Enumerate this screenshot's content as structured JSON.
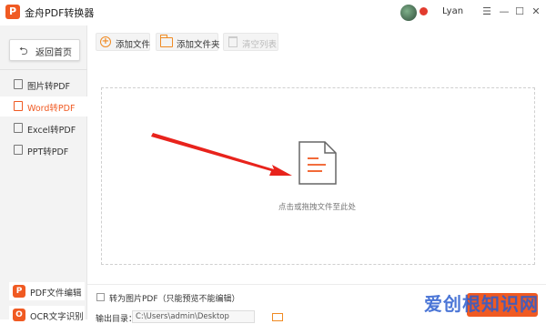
{
  "app": {
    "title": "金舟PDF转换器",
    "logo_text": "P"
  },
  "user": {
    "name": "Lyan"
  },
  "window": {
    "menu": "☰",
    "minimize": "—",
    "maximize": "☐",
    "close": "✕"
  },
  "sidebar": {
    "home": "返回首页",
    "items": [
      {
        "label": "图片转PDF"
      },
      {
        "label": "Word转PDF"
      },
      {
        "label": "Excel转PDF"
      },
      {
        "label": "PPT转PDF"
      }
    ],
    "bottom": [
      {
        "label": "PDF文件编辑"
      },
      {
        "label": "OCR文字识别"
      }
    ]
  },
  "toolbar": {
    "add_file": "添加文件",
    "add_folder": "添加文件夹",
    "clear_list": "清空列表"
  },
  "dropzone": {
    "hint": "点击或拖拽文件至此处"
  },
  "footer": {
    "convert_to_image_pdf": "转为图片PDF（只能预览不能编辑）",
    "output_dir_label": "输出目录：",
    "output_dir_value": "C:\\Users\\admin\\Desktop"
  },
  "watermark": "爱创根知识网",
  "colors": {
    "accent": "#f05a22",
    "arrow": "#e8231c"
  }
}
